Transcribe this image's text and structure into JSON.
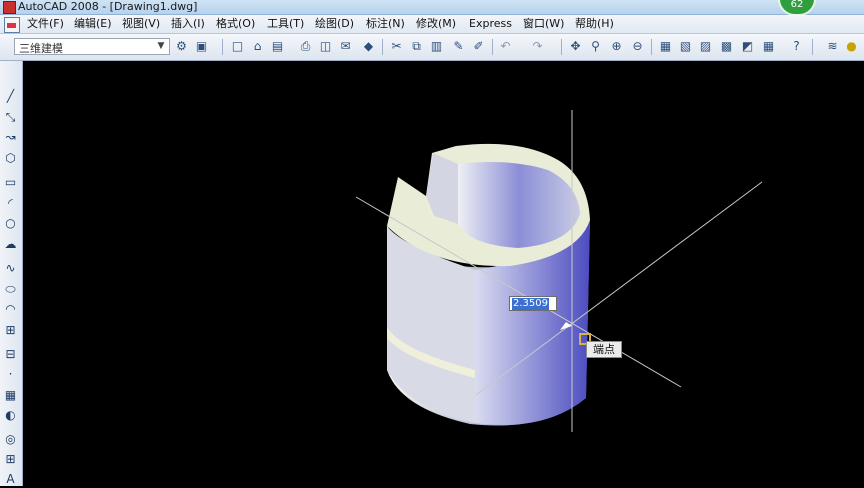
{
  "window": {
    "title": "AutoCAD 2008 - [Drawing1.dwg]",
    "badge": "62"
  },
  "menubar": {
    "items": [
      "文件(F)",
      "编辑(E)",
      "视图(V)",
      "插入(I)",
      "格式(O)",
      "工具(T)",
      "绘图(D)",
      "标注(N)",
      "修改(M)",
      "Express",
      "窗口(W)",
      "帮助(H)"
    ]
  },
  "toolbar": {
    "workspace": "三维建模"
  },
  "drawing": {
    "dynamic_input_value": "2.3509",
    "snap_tooltip": "端点"
  },
  "colors": {
    "canvas_background": "#000000",
    "solid_light": "#e9ecd8",
    "solid_shade": "#5c5cc8",
    "dynamic_input_highlight": "#3b6fd0"
  },
  "icons": {
    "left_toolbar": [
      "line",
      "construction-line",
      "polyline",
      "polygon",
      "rectangle",
      "arc",
      "circle",
      "revision-cloud",
      "spline",
      "ellipse",
      "ellipse-arc",
      "insert-block",
      "make-block",
      "point",
      "hatch",
      "gradient",
      "region",
      "table",
      "multiline-text",
      "add-selected"
    ]
  }
}
